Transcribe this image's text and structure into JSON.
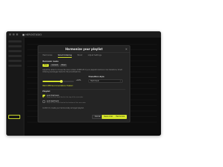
{
  "app": {
    "logo": "■ HEROSTUDIO"
  },
  "modal": {
    "title": "Harmonize your playlist",
    "close_icon": "close-icon",
    "tabs": [
      {
        "label": "Harmonize",
        "active": false
      },
      {
        "label": "Smart Ordering",
        "active": true
      },
      {
        "label": "Mood",
        "active": false
      },
      {
        "label": "Adjust Settings",
        "active": false
      }
    ],
    "harmonic_mode": {
      "label": "Harmonic mode",
      "options": [
        "Keys",
        "Camelot",
        "Mixed"
      ],
      "selected": "Keys"
    },
    "description": "Adjust the slider to choose the max number of BPM off of your playlist's harmonic mix transitions. Smart Ordering rearranges tracks for the smoothest mix.",
    "bpm": {
      "value_text": "+10%",
      "fraction": 0.6
    },
    "transition_style": {
      "label": "Transition style",
      "value": "Each track"
    },
    "preset_note": "Match BPM Recommendations: Enabled",
    "playlist_section": {
      "label": "Playlist",
      "options": [
        {
          "title": "Lock first track",
          "subtitle": "Keep the first track fixed at the top of the new order",
          "checked": true
        },
        {
          "title": "Lock last track",
          "subtitle": "Keep the last track fixed at the bottom of the new order",
          "checked": false
        }
      ]
    },
    "footer_note": "Confirm to create your harmonically arranged playlist.",
    "buttons": {
      "cancel": "Cancel",
      "apply": "Save order",
      "create": "Harmonize"
    }
  },
  "colors": {
    "accent": "#d6e52b",
    "background": "#141414",
    "modal": "#242424"
  }
}
